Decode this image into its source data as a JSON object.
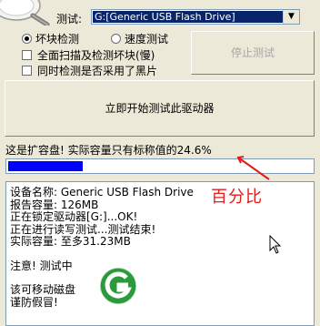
{
  "toolbar": {
    "drive_label": "测试:",
    "drive_selected": "G:[Generic USB Flash Drive]"
  },
  "options": {
    "mode_bad_block": "坏块检测",
    "mode_speed": "速度测试",
    "mode_selected": "bad_block",
    "full_scan": "全面扫描及检测坏块(慢)",
    "same_time_check": "同时检测是否采用了黑片"
  },
  "buttons": {
    "stop": "停止测试",
    "start": "立即开始测试此驱动器"
  },
  "status_text": "这是扩容盘! 实际容量只有标称值的24.6%",
  "progress": {
    "fraction": 0.246,
    "color": "#0000ff"
  },
  "annotation": {
    "label": "百分比",
    "color": "#e21b1b"
  },
  "log_lines": [
    "设备名称: Generic USB Flash Drive",
    "报告容量: 126MB",
    "正在锁定驱动器[G:]...OK!",
    "正在进行读写测试...测试结束!",
    "实际容量: 至多31.23MB",
    "",
    "注意! 测试中",
    "",
    "该可移动磁盘",
    "谨防假冒!"
  ],
  "icons": {
    "watermark_logo": "green-g-logo",
    "cursor": "mouse-pointer-icon",
    "app_logo": "magnifier-logo"
  }
}
